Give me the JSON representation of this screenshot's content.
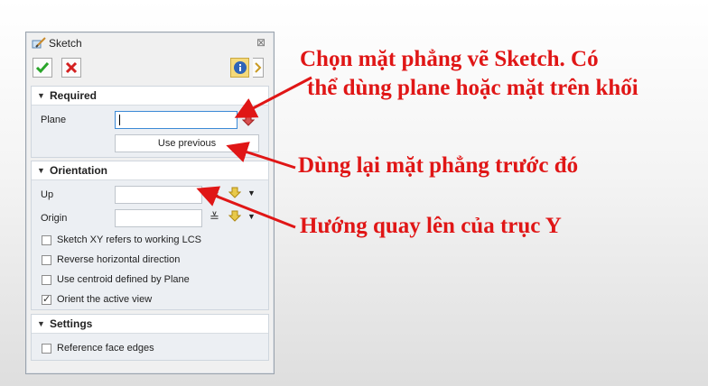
{
  "dialog": {
    "title": "Sketch",
    "toolbar": {
      "ok_icon": "checkmark-icon",
      "cancel_icon": "x-icon",
      "info_icon": "info-icon",
      "side_icon": "panel-arrow-icon"
    },
    "sections": {
      "required": {
        "title": "Required",
        "plane_label": "Plane",
        "plane_value": "",
        "use_previous_label": "Use previous"
      },
      "orientation": {
        "title": "Orientation",
        "up_label": "Up",
        "up_value": "",
        "origin_label": "Origin",
        "origin_value": "",
        "checkboxes": [
          {
            "label": "Sketch XY refers to working LCS",
            "checked": false
          },
          {
            "label": "Reverse horizontal direction",
            "checked": false
          },
          {
            "label": "Use centroid defined by Plane",
            "checked": false
          },
          {
            "label": "Orient the active view",
            "checked": true
          }
        ]
      },
      "settings": {
        "title": "Settings",
        "checkboxes": [
          {
            "label": "Reference face edges",
            "checked": false
          }
        ]
      }
    }
  },
  "annotations": {
    "plane_note_line1": "Chọn mặt phẳng vẽ Sketch. Có",
    "plane_note_line2": "thể dùng plane hoặc mặt trên khối",
    "use_previous_note": "Dùng lại mặt phẳng trước đó",
    "up_note": "Hướng quay lên của trục Y"
  },
  "colors": {
    "annotation": "#e01616",
    "active_field_border": "#3b89d6",
    "ok_green": "#2aa52a",
    "cancel_red": "#d42020"
  }
}
